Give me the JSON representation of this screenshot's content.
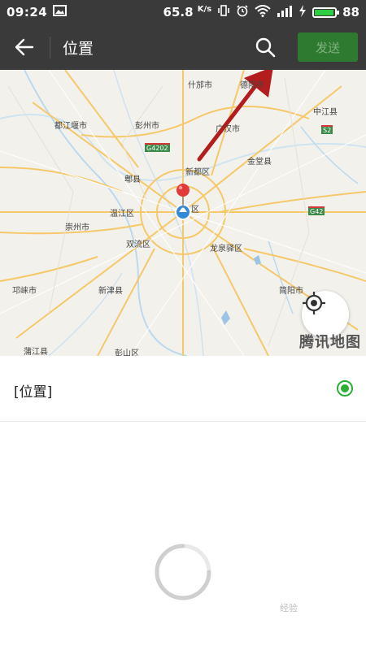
{
  "status_bar": {
    "time": "09:24",
    "speed": "65.8",
    "speed_unit": "K/s",
    "battery": "88",
    "battery_level": 0.88
  },
  "app_bar": {
    "title": "位置",
    "send_label": "发送"
  },
  "map": {
    "labels": [
      "什邡市",
      "德阳市",
      "中江县",
      "都江堰市",
      "彭州市",
      "广汉市",
      "G4202",
      "S2",
      "金堂县",
      "新都区",
      "郫县",
      "温江区",
      "区",
      "G42",
      "崇州市",
      "双流区",
      "龙泉驿区",
      "邛崃市",
      "新津县",
      "简阳市",
      "蒲江县",
      "彭山区"
    ],
    "watermark": "腾讯地图"
  },
  "location_list": {
    "item_label": "[位置]",
    "selected": true
  },
  "colors": {
    "bar_bg": "#3a3a3a",
    "send_bg": "#2f7a31",
    "radio_green": "#2ab135",
    "pin_red": "#e23a3a",
    "arrow": "#b31d1d"
  },
  "watermark_corner": "经验"
}
